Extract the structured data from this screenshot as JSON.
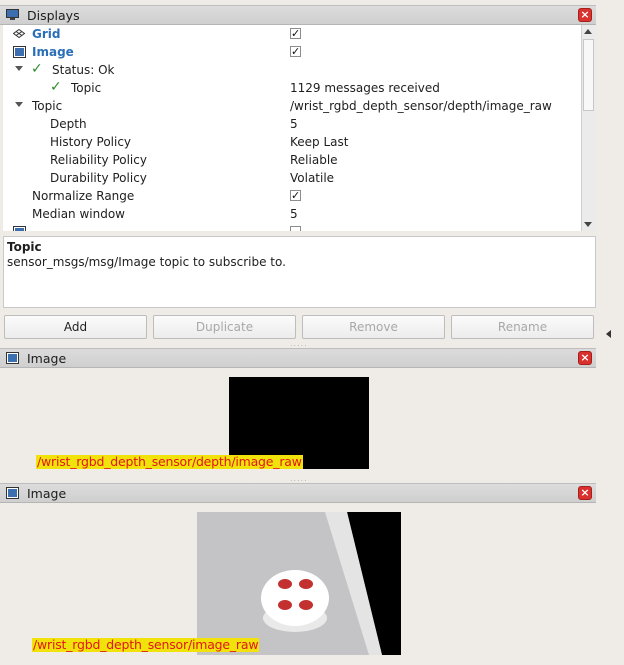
{
  "displays_panel": {
    "title": "Displays",
    "close_label": "×",
    "rows": {
      "grid": {
        "name": "Grid",
        "checked": "✓"
      },
      "image": {
        "name": "Image",
        "checked": "✓"
      },
      "status": {
        "name": "Status: Ok"
      },
      "status_topic": {
        "name": "Topic",
        "value": "1129 messages received"
      },
      "topic": {
        "name": "Topic",
        "value": "/wrist_rgbd_depth_sensor/depth/image_raw"
      },
      "depth": {
        "name": "Depth",
        "value": "5"
      },
      "history": {
        "name": "History Policy",
        "value": "Keep Last"
      },
      "reliability": {
        "name": "Reliability Policy",
        "value": "Reliable"
      },
      "durability": {
        "name": "Durability Policy",
        "value": "Volatile"
      },
      "normalize": {
        "name": "Normalize Range",
        "checked": "✓"
      },
      "median": {
        "name": "Median window",
        "value": "5"
      }
    }
  },
  "description": {
    "title": "Topic",
    "text": "sensor_msgs/msg/Image topic to subscribe to."
  },
  "buttons": {
    "add": "Add",
    "duplicate": "Duplicate",
    "remove": "Remove",
    "rename": "Rename"
  },
  "image_panels": [
    {
      "title": "Image",
      "close_label": "×",
      "overlay": "/wrist_rgbd_depth_sensor/depth/image_raw"
    },
    {
      "title": "Image",
      "close_label": "×",
      "overlay": "/wrist_rgbd_depth_sensor/image_raw"
    }
  ],
  "colors": {
    "link_blue": "#2a6fb8",
    "status_green": "#2e8b2e",
    "close_red": "#d9312d",
    "overlay_red": "#e01818",
    "overlay_yellow": "#f2e20b"
  }
}
